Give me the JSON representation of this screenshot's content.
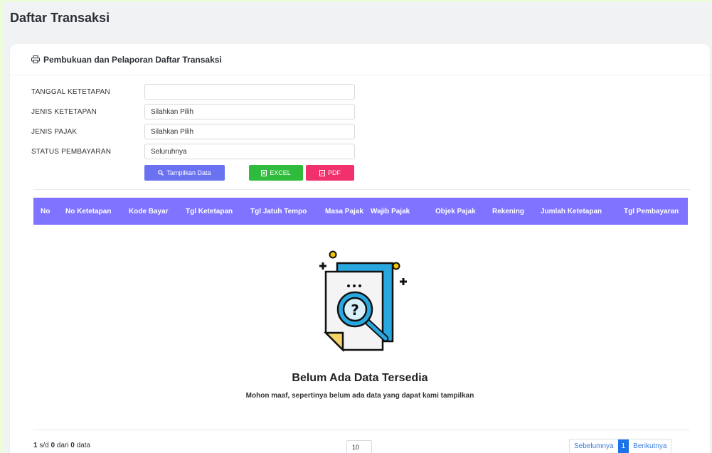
{
  "page": {
    "title": "Daftar Transaksi"
  },
  "card": {
    "title": "Pembukuan dan Pelaporan Daftar Transaksi",
    "icon": "printer-icon"
  },
  "form": {
    "tanggal_label": "TANGGAL KETETAPAN",
    "tanggal_value": "",
    "jenis_ketetapan_label": "JENIS KETETAPAN",
    "jenis_ketetapan_value": "Silahkan Pilih",
    "jenis_pajak_label": "JENIS PAJAK",
    "jenis_pajak_value": "Silahkan Pilih",
    "status_label": "STATUS PEMBAYARAN",
    "status_value": "Seluruhnya"
  },
  "buttons": {
    "tampilkan": "Tampilkan Data",
    "excel": "EXCEL",
    "pdf": "PDF"
  },
  "table": {
    "columns": [
      "No",
      "No Ketetapan",
      "Kode Bayar",
      "Tgl Ketetapan",
      "Tgl Jatuh Tempo",
      "Masa Pajak",
      "Wajib Pajak",
      "Objek Pajak",
      "Rekening",
      "Jumlah Ketetapan",
      "Tgl Pembayaran"
    ]
  },
  "empty": {
    "title": "Belum Ada Data Tersedia",
    "subtitle": "Mohon maaf, sepertinya belum ada data yang dapat kami tampilkan"
  },
  "footer": {
    "from": "1",
    "sep1": " s/d ",
    "to": "0",
    "sep2": " dari ",
    "total": "0",
    "suffix": " data",
    "per_page": "10"
  },
  "pagination": {
    "prev": "Sebelumnya",
    "current": "1",
    "next": "Berikutnya"
  },
  "colors": {
    "header_bg": "#7f73ff",
    "primary": "#6b72f2",
    "excel": "#2fbb3c",
    "pdf": "#f0316b",
    "link": "#1a73e8"
  }
}
